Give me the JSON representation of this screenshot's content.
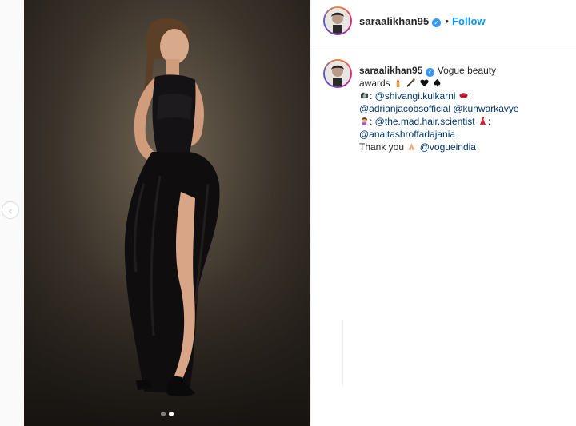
{
  "post": {
    "username": "saraalikhan95",
    "header_separator": "•",
    "follow_label": "Follow",
    "verified_glyph": "✓",
    "carousel": {
      "slide_count": 2,
      "active_index": 1
    },
    "caption": {
      "lines": [
        {
          "text": "Vogue beauty"
        },
        {
          "text": "awards"
        },
        {
          "mention": "@shivangi.kulkarni",
          "suffix": ":"
        },
        {
          "mention1": "@adrianjacobsofficial",
          "mention2": "@kunwarkavye"
        },
        {
          "mention": "@the.mad.hair.scientist",
          "suffix": ":"
        },
        {
          "mention": "@anaitashroffadajania"
        },
        {
          "text": "Thank you",
          "mention": "@vogueindia"
        }
      ]
    }
  },
  "nav": {
    "prev_glyph": "‹"
  },
  "colors": {
    "link": "#0095f6",
    "mention": "#00376b",
    "text": "#262626",
    "verified": "#3897f0"
  },
  "icons": {
    "prev": "chevron-left-icon",
    "verified": "verified-badge-icon"
  }
}
